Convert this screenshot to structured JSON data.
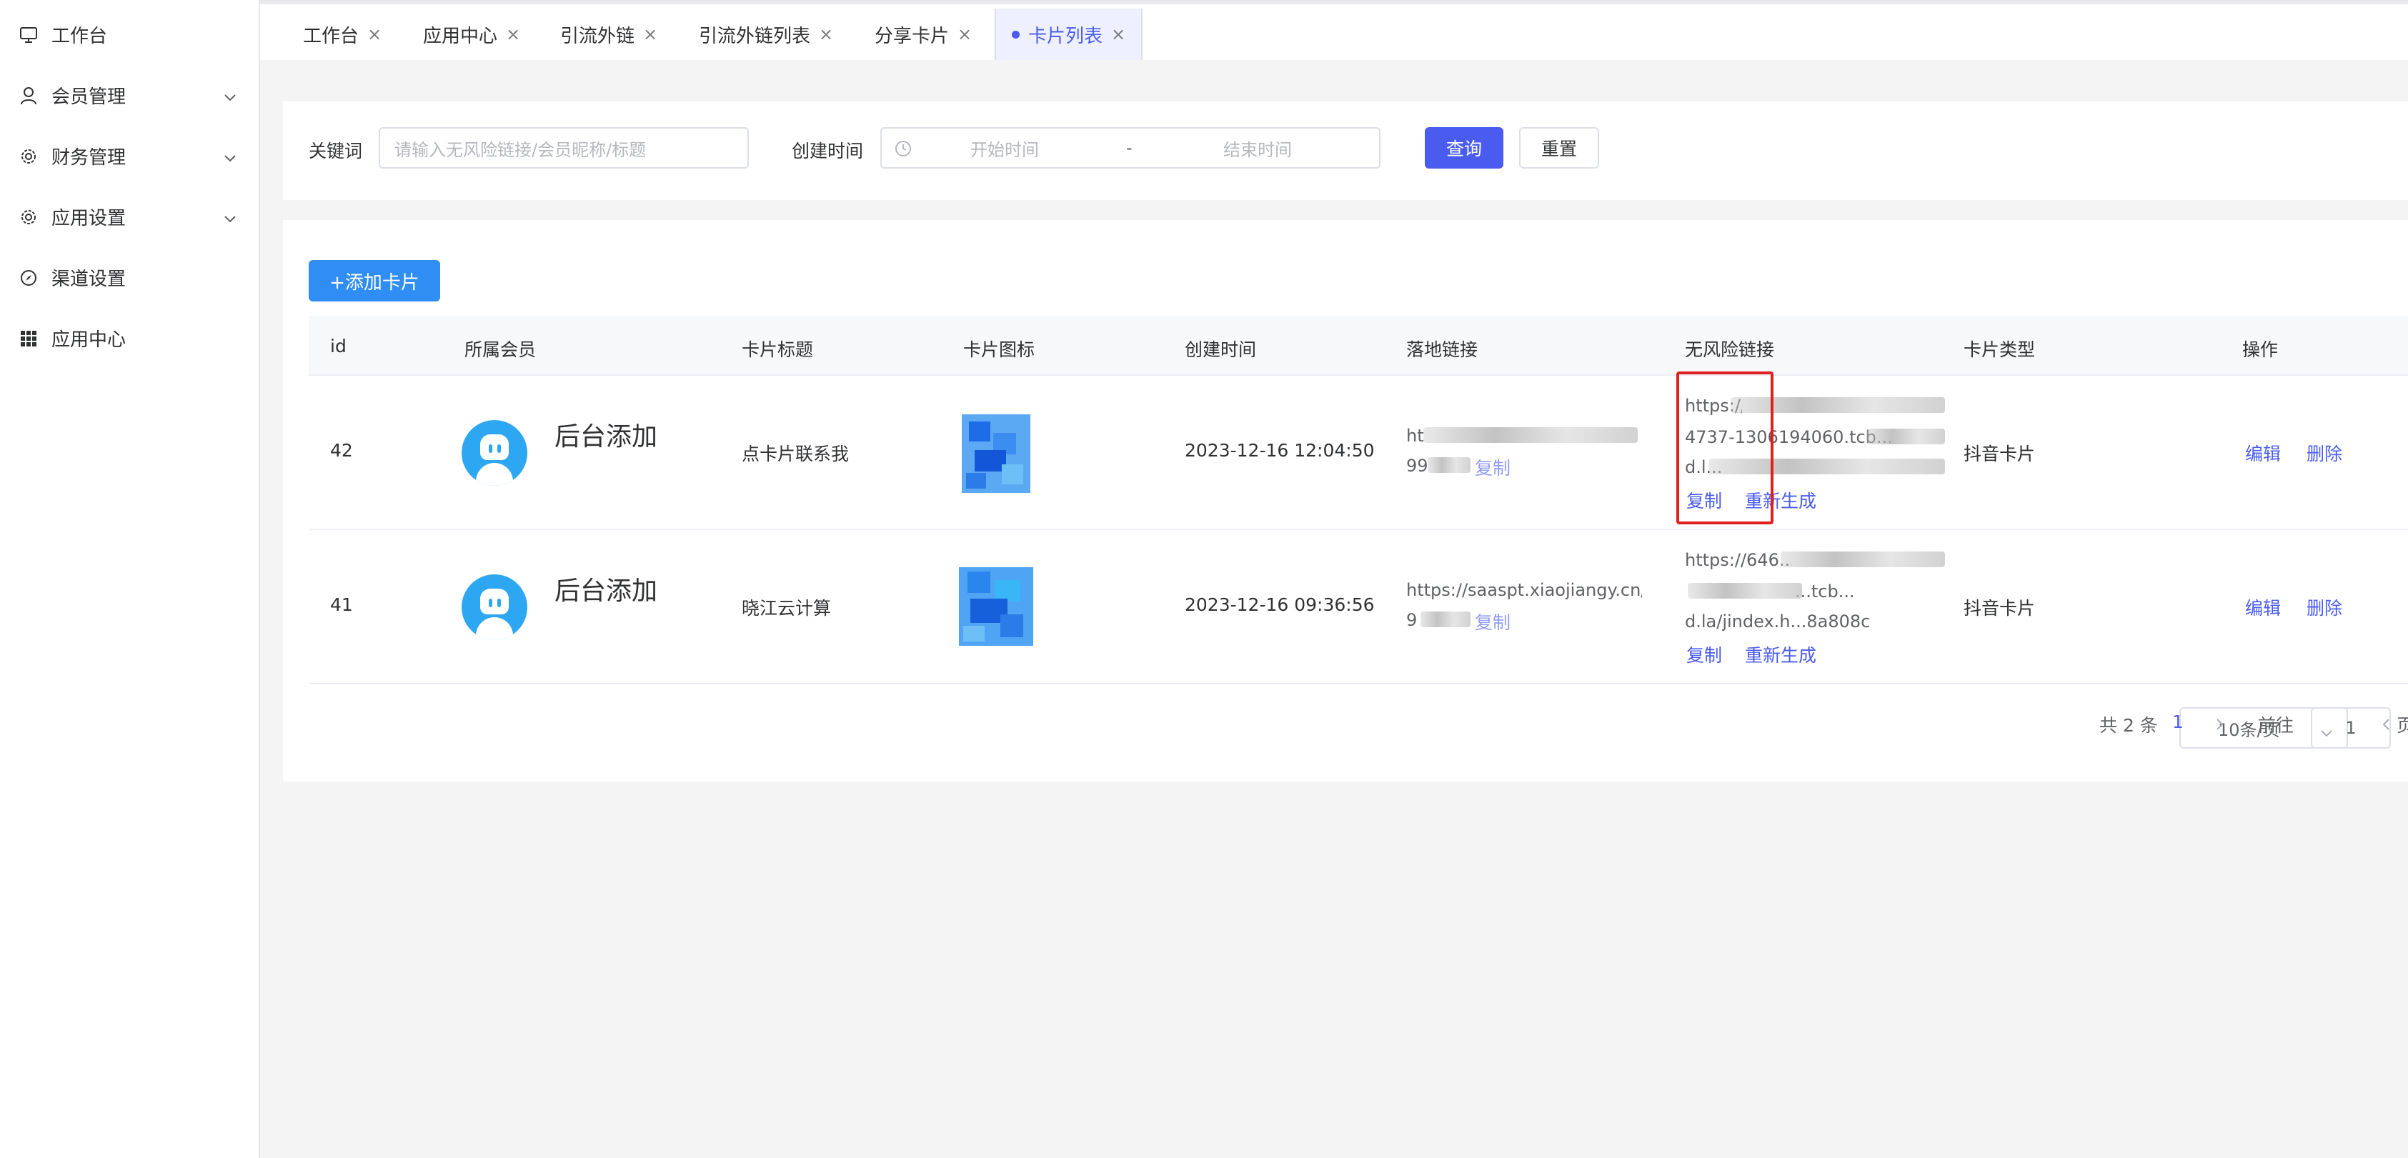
{
  "sidebar": {
    "items": [
      {
        "label": "工作台",
        "icon": "monitor-icon"
      },
      {
        "label": "会员管理",
        "icon": "user-icon",
        "expandable": true
      },
      {
        "label": "财务管理",
        "icon": "gear-icon",
        "expandable": true
      },
      {
        "label": "应用设置",
        "icon": "gear-icon",
        "expandable": true
      },
      {
        "label": "渠道设置",
        "icon": "compass-icon"
      },
      {
        "label": "应用中心",
        "icon": "grid-icon"
      }
    ]
  },
  "tabs": [
    {
      "label": "工作台",
      "active": false
    },
    {
      "label": "应用中心",
      "active": false
    },
    {
      "label": "引流外链",
      "active": false
    },
    {
      "label": "引流外链列表",
      "active": false
    },
    {
      "label": "分享卡片",
      "active": false
    },
    {
      "label": "卡片列表",
      "active": true
    }
  ],
  "tab_close_glyph": "×",
  "filter": {
    "keyword_label": "关键词",
    "keyword_placeholder": "请输入无风险链接/会员昵称/标题",
    "time_label": "创建时间",
    "start_placeholder": "开始时间",
    "range_sep": "-",
    "end_placeholder": "结束时间",
    "query_button": "查询",
    "reset_button": "重置"
  },
  "table": {
    "add_button": "+添加卡片",
    "columns": [
      "id",
      "所属会员",
      "卡片标题",
      "卡片图标",
      "创建时间",
      "落地链接",
      "无风险链接",
      "卡片类型",
      "操作"
    ],
    "rows": [
      {
        "id": "42",
        "member": "后台添加",
        "title": "点卡片联系我",
        "created": "2023-12-16 12:04:50",
        "landing_line1": "ht",
        "landing_line2": "99",
        "landing_copy": "复制",
        "safe_line1": "https://...",
        "safe_line2": "4737-1306194060.tcb...",
        "safe_line3": "d.l...",
        "safe_copy": "复制",
        "safe_regen": "重新生成",
        "type": "抖音卡片",
        "edit": "编辑",
        "delete": "删除"
      },
      {
        "id": "41",
        "member": "后台添加",
        "title": "晓江云计算",
        "created": "2023-12-16 09:36:56",
        "landing_line1": "https://saaspt.xiaojiangy.cn/c",
        "landing_line2": "9",
        "landing_copy": "复制",
        "safe_line1": "https://646...",
        "safe_line2": "...tcb...",
        "safe_line3": "d.la/jindex.h...8a808c",
        "safe_copy": "复制",
        "safe_regen": "重新生成",
        "type": "抖音卡片",
        "edit": "编辑",
        "delete": "删除"
      }
    ]
  },
  "pagination": {
    "total": "共 2 条",
    "page_size": "10条/页",
    "current_page": "1",
    "goto_label": "前往",
    "goto_value": "1",
    "page_suffix": "页"
  },
  "colors": {
    "primary": "#4a5cf0",
    "add_button": "#2f8df4",
    "highlight_box": "#e02020",
    "avatar": "#2ea7f2"
  }
}
